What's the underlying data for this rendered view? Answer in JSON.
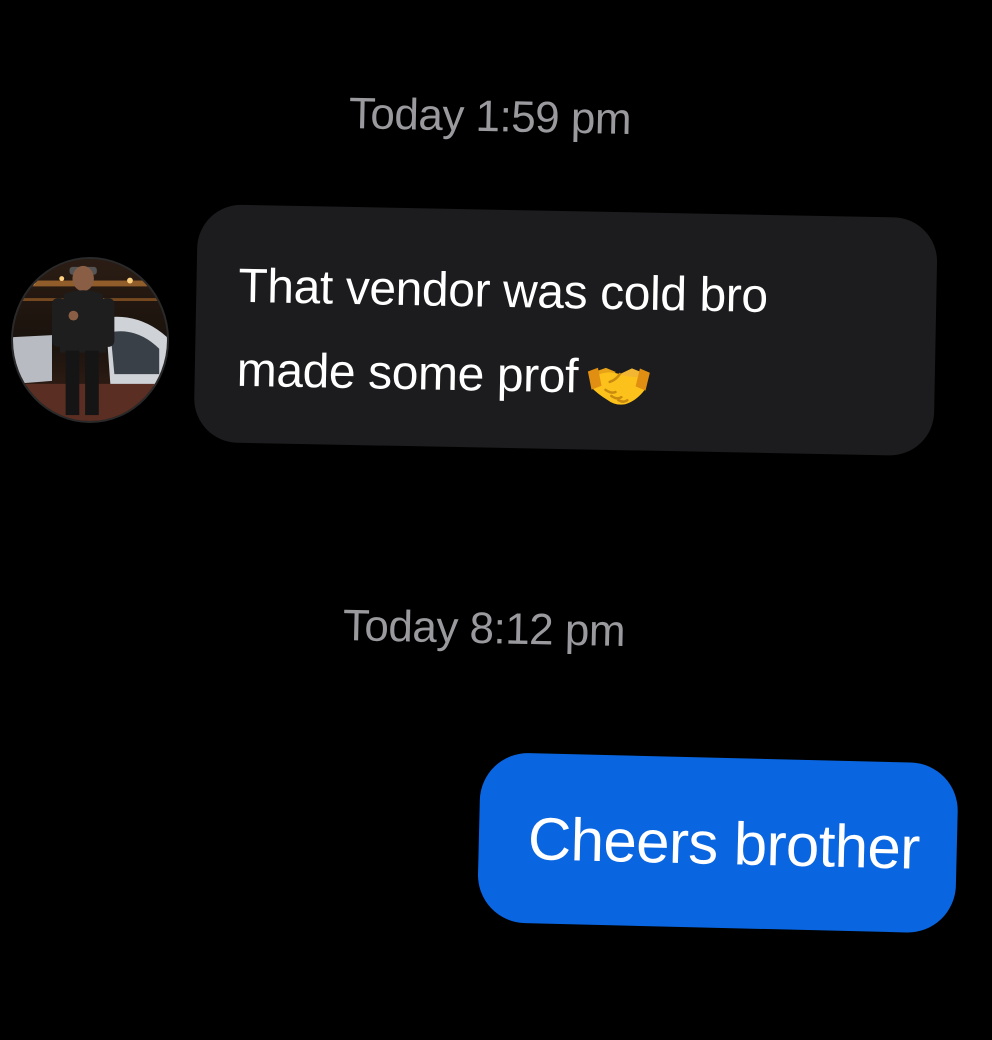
{
  "conversation": {
    "timestamps": [
      "Today 1:59 pm",
      "Today 8:12 pm"
    ],
    "incoming": {
      "line1": "That vendor was cold bro",
      "line2": "made some prof",
      "emoji": "handshake-icon"
    },
    "outgoing": {
      "text": "Cheers brother"
    }
  },
  "colors": {
    "background": "#000000",
    "incoming_bubble": "#1c1c1e",
    "outgoing_bubble": "#0a66e0",
    "timestamp": "#9a9a9e",
    "text": "#ffffff"
  }
}
